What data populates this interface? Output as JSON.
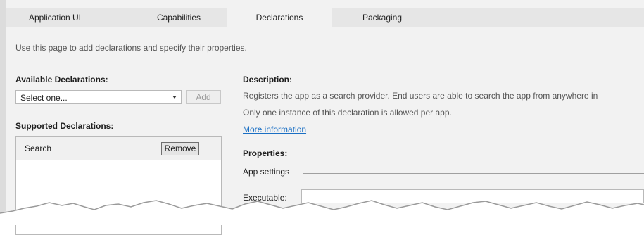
{
  "tabs": [
    {
      "label": "Application UI",
      "active": false
    },
    {
      "label": "Capabilities",
      "active": false
    },
    {
      "label": "Declarations",
      "active": true
    },
    {
      "label": "Packaging",
      "active": false
    }
  ],
  "intro": "Use this page to add declarations and specify their properties.",
  "available": {
    "heading": "Available Declarations:",
    "selected": "Select one...",
    "add_label": "Add"
  },
  "supported": {
    "heading": "Supported Declarations:",
    "items": [
      {
        "label": "Search",
        "remove_label": "Remove"
      }
    ]
  },
  "description": {
    "heading": "Description:",
    "line1": "Registers the app as a search provider. End users are able to search the app from anywhere in",
    "line2": "Only one instance of this declaration is allowed per app.",
    "link": "More information"
  },
  "properties": {
    "heading": "Properties:",
    "group": "App settings",
    "executable_label": "Executable:",
    "executable_value": ""
  },
  "colors": {
    "accent_link": "#1a6fc4",
    "panel": "#f2f2f2",
    "tabstrip": "#e6e6e6"
  }
}
